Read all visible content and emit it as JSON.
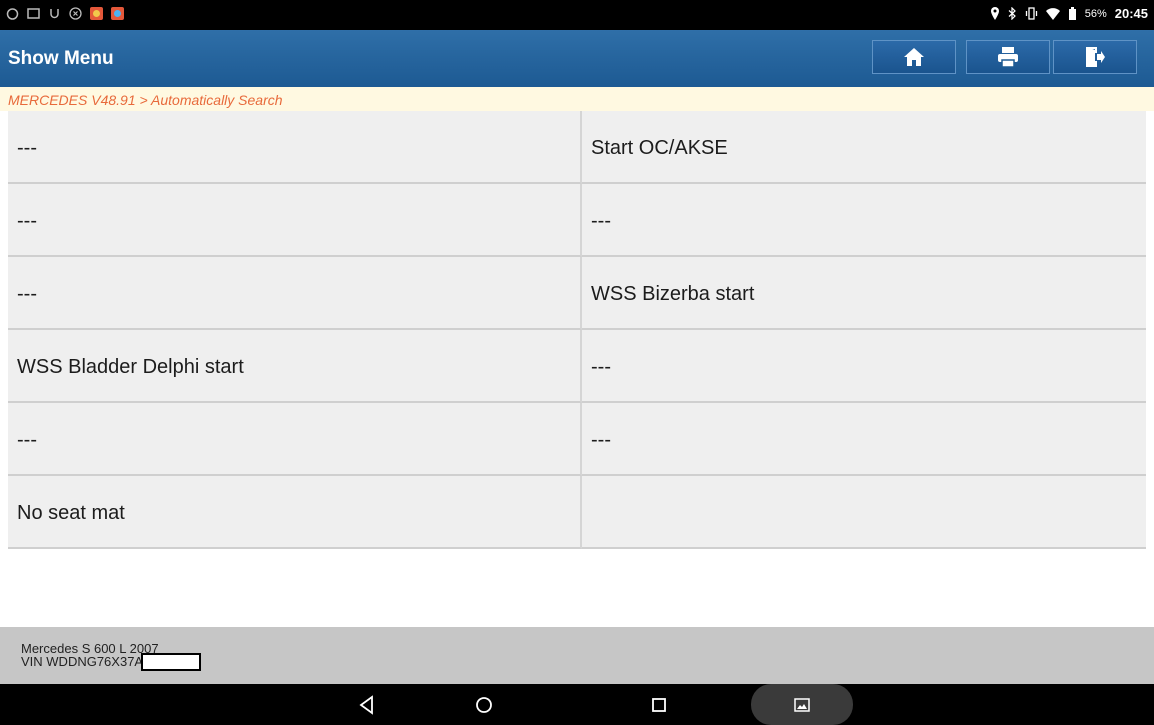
{
  "statusbar": {
    "battery": "56%",
    "time": "20:45"
  },
  "header": {
    "title": "Show Menu"
  },
  "breadcrumb": "MERCEDES V48.91 > Automatically Search",
  "menu": {
    "rows": [
      [
        "---",
        "Start OC/AKSE"
      ],
      [
        "---",
        "---"
      ],
      [
        "---",
        "WSS Bizerba start"
      ],
      [
        "WSS Bladder Delphi start",
        "---"
      ],
      [
        "---",
        "---"
      ],
      [
        "No seat mat",
        ""
      ]
    ]
  },
  "footer": {
    "vehicle": "Mercedes S 600 L 2007",
    "vin": "VIN WDDNG76X37A1"
  }
}
